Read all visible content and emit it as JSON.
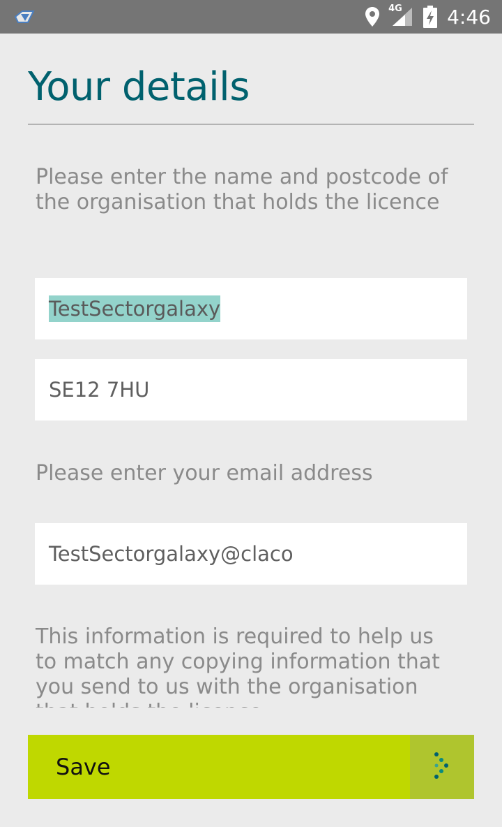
{
  "status_bar": {
    "time": "4:46",
    "network": "4G",
    "icons": [
      "app-logo-icon",
      "location-icon",
      "signal-icon",
      "battery-charging-icon"
    ]
  },
  "header": {
    "title": "Your details"
  },
  "form": {
    "org_instruction": "Please enter the name and postcode of the organisation that holds the licence",
    "org_name_value": "TestSectorgalaxy",
    "postcode_value": "SE12 7HU",
    "email_instruction": "Please enter your email address",
    "email_value": "TestSectorgalaxy@claco",
    "info_text": "This information is required to help us to match any copying information that you send to us with the organisation that holds the licence"
  },
  "footer": {
    "save_label": "Save",
    "save_icon": "dotted-arrow-icon"
  },
  "colors": {
    "title": "#00616e",
    "accent": "#bfd800",
    "accent_dark": "#afc52e",
    "selection": "#93d3cb",
    "background": "#ebebeb"
  }
}
